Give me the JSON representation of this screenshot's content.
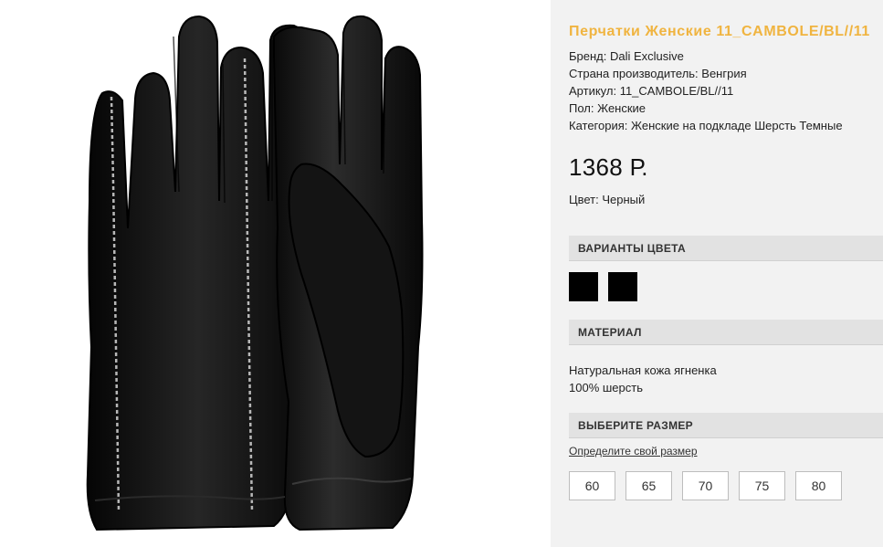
{
  "product": {
    "title": "Перчатки Женские 11_CAMBOLE/BL//11",
    "specs": [
      "Бренд: Dali Exclusive",
      "Страна производитель: Венгрия",
      "Артикул: 11_CAMBOLE/BL//11",
      "Пол: Женские",
      "Категория: Женские на подкладе Шерсть Темные"
    ],
    "price": "1368 Р.",
    "color_line": "Цвет: Черный",
    "accent_color": "#f0b440"
  },
  "colors_section": {
    "header": "ВАРИАНТЫ ЦВЕТА",
    "swatches": [
      "#000000",
      "#000000"
    ]
  },
  "material_section": {
    "header": "МАТЕРИАЛ",
    "lines": [
      "Натуральная кожа ягненка",
      "100% шерсть"
    ]
  },
  "size_section": {
    "header": "ВЫБЕРИТЕ РАЗМЕР",
    "link": "Определите свой размер",
    "sizes": [
      "60",
      "65",
      "70",
      "75",
      "80"
    ]
  },
  "image": {
    "icon": "gloves-photo"
  }
}
